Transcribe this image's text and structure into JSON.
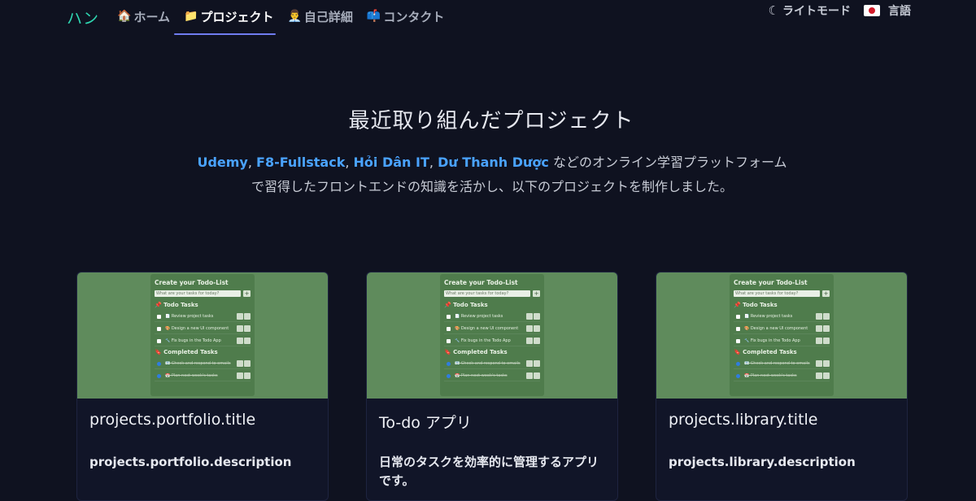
{
  "nav": {
    "brand": "ハン",
    "items": [
      {
        "icon": "🏠",
        "label": "ホーム"
      },
      {
        "icon": "📁",
        "label": "プロジェクト"
      },
      {
        "icon": "👨‍💼",
        "label": "自己詳細"
      },
      {
        "icon": "📫",
        "label": "コンタクト"
      }
    ],
    "theme_label": "ライトモード",
    "language_label": "言語"
  },
  "hero": {
    "title": "最近取り組んだプロジェクト",
    "platforms": [
      "Udemy",
      "F8-Fullstack",
      "Hỏi Dân IT",
      "Dư Thanh Dược"
    ],
    "sep": ",",
    "intro_tail": "などのオンライン学習プラットフォーム",
    "intro_line2": "で習得したフロントエンドの知識を活かし、以下のプロジェクトを制作しました。"
  },
  "todo_preview": {
    "heading": "Create your Todo-List",
    "placeholder": "What are your tasks for today?",
    "plus": "+",
    "todo_section": "📌 Todo Tasks",
    "tasks": [
      "📄 Review project tasks",
      "🎨 Design a new UI component",
      "🔧 Fix bugs in the Todo App"
    ],
    "completed_section": "🔖 Completed Tasks",
    "completed": [
      "📧 Check and respond to emails",
      "📅 Plan next week's tasks"
    ]
  },
  "projects": [
    {
      "title": "projects.portfolio.title",
      "description": "projects.portfolio.description"
    },
    {
      "title": "To-do アプリ",
      "description": "日常のタスクを効率的に管理するアプリです。"
    },
    {
      "title": "projects.library.title",
      "description": "projects.library.description"
    }
  ]
}
